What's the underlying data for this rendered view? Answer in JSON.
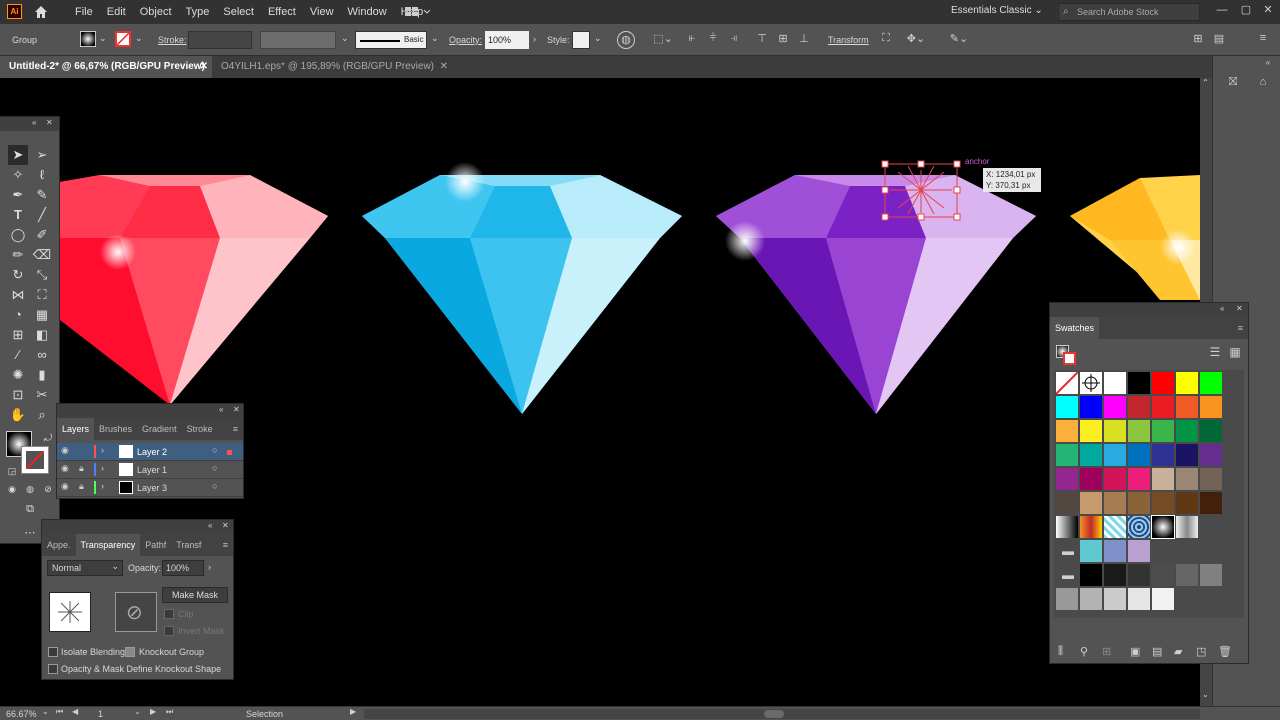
{
  "menu": {
    "app_logo": "Ai",
    "items": [
      "File",
      "Edit",
      "Object",
      "Type",
      "Select",
      "Effect",
      "View",
      "Window",
      "Help"
    ],
    "workspace": "Essentials Classic",
    "search_placeholder": "Search Adobe Stock"
  },
  "control": {
    "selection_label": "Group",
    "stroke_label": "Stroke:",
    "brush_label": "Basic",
    "opacity_label": "Opacity:",
    "opacity_value": "100%",
    "style_label": "Style:",
    "transform_label": "Transform"
  },
  "tabs": [
    {
      "label": "Untitled-2* @ 66,67% (RGB/GPU Preview)"
    },
    {
      "label": "O4YILH1.eps* @ 195,89% (RGB/GPU Preview)"
    }
  ],
  "canvas": {
    "anchor_label": "anchor",
    "coords_x": "X: 1234,01 px",
    "coords_y": "Y: 370,31 px"
  },
  "layers_panel": {
    "tabs": [
      "Layers",
      "Brushes",
      "Gradient",
      "Stroke"
    ],
    "layers": [
      {
        "name": "Layer 2",
        "color": "#ff4f4f"
      },
      {
        "name": "Layer 1",
        "color": "#4f7fff"
      },
      {
        "name": "Layer 3",
        "color": "#4fff4f"
      }
    ]
  },
  "transparency_panel": {
    "tabs": [
      "Appe.",
      "Transparency",
      "Pathf",
      "Transf"
    ],
    "blend_mode": "Normal",
    "opacity_label": "Opacity:",
    "opacity_value": "100%",
    "make_mask": "Make Mask",
    "clip": "Clip",
    "invert_mask": "Invert Mask",
    "isolate_blending": "Isolate Blending",
    "knockout_group": "Knockout Group",
    "opacity_mask_define": "Opacity & Mask Define Knockout Shape"
  },
  "swatches_panel": {
    "title": "Swatches",
    "rows": [
      [
        "#ffffff",
        "#ffffff",
        "#000000",
        "#ff0000",
        "#ffff00",
        "#00ff00"
      ],
      [
        "#00ffff",
        "#0000ff",
        "#ff00ff",
        "#c1272d",
        "#ed1c24",
        "#f15a24",
        "#f7931e"
      ],
      [
        "#fbb03b",
        "#fcee21",
        "#d9e021",
        "#8cc63f",
        "#39b54a",
        "#009245",
        "#006837"
      ],
      [
        "#22b573",
        "#00a99d",
        "#29abe2",
        "#0071bc",
        "#2e3192",
        "#1b1464",
        "#662d91"
      ],
      [
        "#93278f",
        "#9e005d",
        "#d4145a",
        "#ed1e79",
        "#c7b299",
        "#998675",
        "#736357"
      ],
      [
        "#534741",
        "#c69c6d",
        "#a67c52",
        "#8c6239",
        "#754c24",
        "#603813",
        "#42210b"
      ]
    ],
    "pattern_group": [
      "#60c8d0",
      "#7f90c8",
      "#b8a0d0"
    ],
    "gray_group": [
      "#000000",
      "#1a1a1a",
      "#333333",
      "#4d4d4d",
      "#666666",
      "#808080"
    ],
    "light_gray": [
      "#999999",
      "#b3b3b3",
      "#cccccc",
      "#e6e6e6",
      "#f2f2f2"
    ]
  },
  "status": {
    "zoom": "66.67%",
    "artboard": "1",
    "tool": "Selection"
  }
}
